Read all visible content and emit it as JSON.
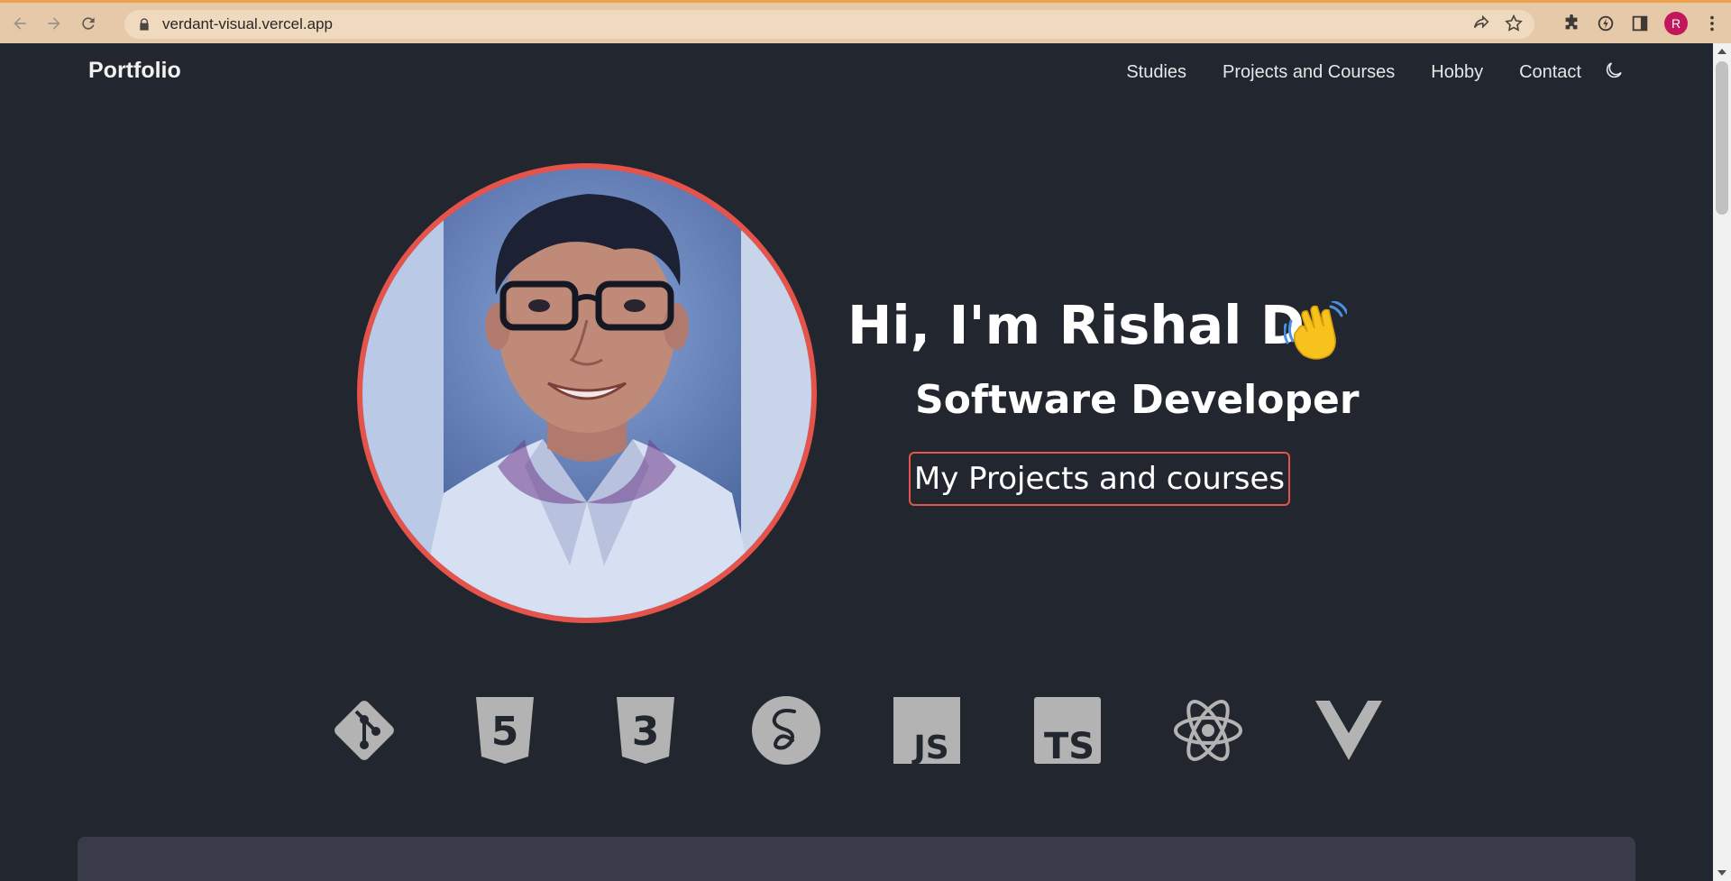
{
  "browser": {
    "url": "verdant-visual.vercel.app",
    "profile_initial": "R",
    "colors": {
      "toolbar": "#e6c9a8",
      "omnibox": "#efd9bf",
      "profile": "#c2185b"
    }
  },
  "nav": {
    "brand": "Portfolio",
    "links": [
      {
        "label": "Studies"
      },
      {
        "label": "Projects and Courses"
      },
      {
        "label": "Hobby"
      },
      {
        "label": "Contact"
      }
    ],
    "theme_toggle_icon": "moon-icon"
  },
  "hero": {
    "title": "Hi, I'm Rishal D",
    "wave_icon": "waving-hand-icon",
    "subtitle": "Software Developer",
    "cta_label": "My Projects and courses",
    "accent_color": "#e5534b",
    "photo": "profile-photo"
  },
  "tech_icons": [
    {
      "name": "git-icon",
      "label": ""
    },
    {
      "name": "html5-icon",
      "label": "5"
    },
    {
      "name": "css3-icon",
      "label": "3"
    },
    {
      "name": "sass-icon",
      "label": ""
    },
    {
      "name": "javascript-icon",
      "label": "JS"
    },
    {
      "name": "typescript-icon",
      "label": "TS"
    },
    {
      "name": "react-icon",
      "label": ""
    },
    {
      "name": "vue-icon",
      "label": ""
    }
  ],
  "theme": {
    "background": "#22262f",
    "card": "#393c48",
    "icon_color": "#b3b3b3"
  }
}
